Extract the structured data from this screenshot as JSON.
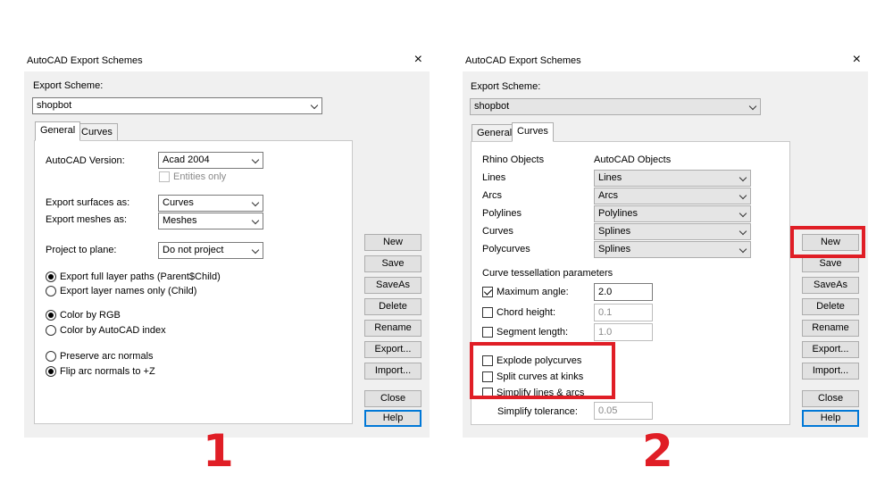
{
  "accent_red": "#e01e26",
  "dialog1": {
    "title": "AutoCAD Export Schemes",
    "close_icon": "×",
    "scheme_label": "Export Scheme:",
    "scheme_value": "shopbot",
    "tabs": [
      "General",
      "Curves"
    ],
    "version_label": "AutoCAD Version:",
    "version_value": "Acad 2004",
    "entities_only": "Entities only",
    "surfaces_label": "Export surfaces as:",
    "surfaces_value": "Curves",
    "meshes_label": "Export meshes as:",
    "meshes_value": "Meshes",
    "project_label": "Project to plane:",
    "project_value": "Do not project",
    "radio_full_paths": "Export full layer paths (Parent$Child)",
    "radio_names_only": "Export layer names only (Child)",
    "radio_rgb": "Color by RGB",
    "radio_aci": "Color by AutoCAD index",
    "radio_preserve": "Preserve arc normals",
    "radio_flip": "Flip arc normals to +Z",
    "buttons": [
      "New",
      "Save",
      "SaveAs",
      "Delete",
      "Rename",
      "Export...",
      "Import...",
      "Close",
      "Help"
    ]
  },
  "dialog2": {
    "title": "AutoCAD Export Schemes",
    "close_icon": "×",
    "scheme_label": "Export Scheme:",
    "scheme_value": "shopbot",
    "tabs": [
      "General",
      "Curves"
    ],
    "col_rhino": "Rhino Objects",
    "col_autocad": "AutoCAD Objects",
    "mappings": [
      {
        "rhino": "Lines",
        "autocad": "Lines"
      },
      {
        "rhino": "Arcs",
        "autocad": "Arcs"
      },
      {
        "rhino": "Polylines",
        "autocad": "Polylines"
      },
      {
        "rhino": "Curves",
        "autocad": "Splines"
      },
      {
        "rhino": "Polycurves",
        "autocad": "Splines"
      }
    ],
    "tess_heading": "Curve tessellation parameters",
    "max_angle_label": "Maximum angle:",
    "max_angle_value": "2.0",
    "chord_label": "Chord height:",
    "chord_value": "0.1",
    "segment_label": "Segment length:",
    "segment_value": "1.0",
    "explode": "Explode polycurves",
    "split": "Split curves at kinks",
    "simplify": "Simplify lines & arcs",
    "simplify_tol_label": "Simplify tolerance:",
    "simplify_tol_value": "0.05",
    "buttons": [
      "New",
      "Save",
      "SaveAs",
      "Delete",
      "Rename",
      "Export...",
      "Import...",
      "Close",
      "Help"
    ]
  },
  "labels": {
    "one": "1",
    "two": "2"
  }
}
